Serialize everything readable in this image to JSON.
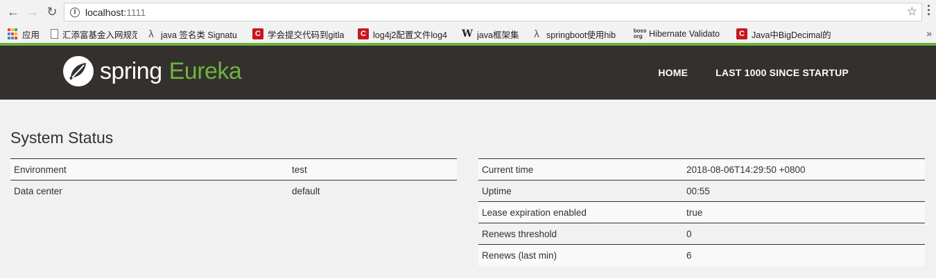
{
  "browser": {
    "url_host": "localhost:",
    "url_port": "1111",
    "bookmarks": [
      {
        "icon": "apps-icon",
        "label": "应用"
      },
      {
        "icon": "doc-icon",
        "label": "汇添富基金入网规范"
      },
      {
        "icon": "lambda-icon",
        "label": "java 签名类 Signatu"
      },
      {
        "icon": "csdn-icon",
        "label": "学会提交代码到gitla"
      },
      {
        "icon": "csdn-icon",
        "label": "log4j2配置文件log4"
      },
      {
        "icon": "wikipedia-icon",
        "label": "java框架集"
      },
      {
        "icon": "lambda-icon",
        "label": "springboot使用hib"
      },
      {
        "icon": "jboss-icon",
        "label": "Hibernate Validato"
      },
      {
        "icon": "csdn-icon",
        "label": "Java中BigDecimal的"
      }
    ],
    "overflow_label": "»"
  },
  "header": {
    "logo_spring": "spring",
    "logo_eureka": "Eureka",
    "nav": [
      "HOME",
      "LAST 1000 SINCE STARTUP"
    ]
  },
  "main": {
    "title": "System Status",
    "left_table": [
      {
        "key": "Environment",
        "value": "test"
      },
      {
        "key": "Data center",
        "value": "default"
      }
    ],
    "right_table": [
      {
        "key": "Current time",
        "value": "2018-08-06T14:29:50 +0800"
      },
      {
        "key": "Uptime",
        "value": "00:55"
      },
      {
        "key": "Lease expiration enabled",
        "value": "true"
      },
      {
        "key": "Renews threshold",
        "value": "0"
      },
      {
        "key": "Renews (last min)",
        "value": "6"
      }
    ]
  },
  "colors": {
    "spring_green": "#6db33f",
    "header_bg": "#34302d",
    "csdn_red": "#c8161d"
  }
}
